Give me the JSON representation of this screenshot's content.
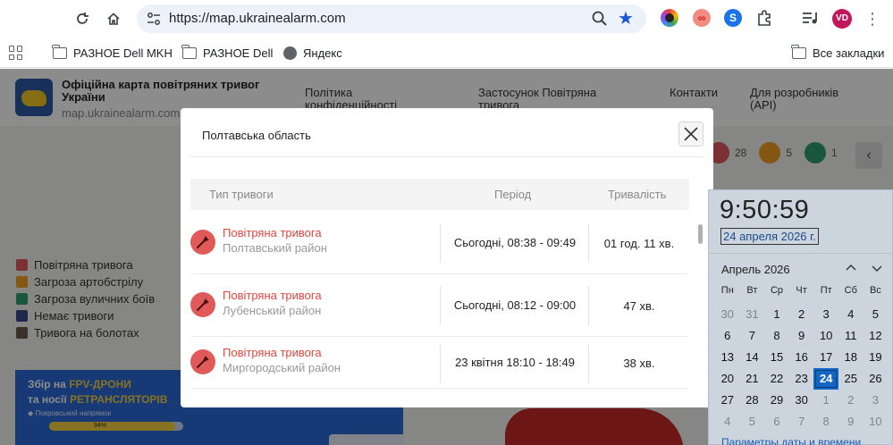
{
  "browser": {
    "url": "https://map.ukrainealarm.com",
    "profile_initials": "VD",
    "ext_infinity": "∞",
    "ext_shazam": "S",
    "bookmarks": [
      {
        "label": "РАЗНОЕ Dell MKH",
        "icon": "folder-icon"
      },
      {
        "label": "РАЗНОЕ Dell",
        "icon": "folder-icon"
      },
      {
        "label": "Яндекс",
        "icon": "globe-icon"
      }
    ],
    "all_bookmarks": "Все закладки"
  },
  "site": {
    "title": "Офіційна карта повітряних тривог України",
    "domain": "map.ukrainealarm.com",
    "nav": [
      "Політика конфіденційності",
      "Застосунок Повітряна тривога",
      "Контакти",
      "Для розробників (API)"
    ],
    "legend": [
      {
        "label": "Повітряна тривога",
        "color": "#e05a5a"
      },
      {
        "label": "Загроза артобстрілу",
        "color": "#f0a020"
      },
      {
        "label": "Загроза вуличних боїв",
        "color": "#2f9e6e"
      },
      {
        "label": "Немає тривоги",
        "color": "#3a4a8a"
      },
      {
        "label": "Тривога на болотах",
        "color": "#6b5a4e"
      }
    ],
    "stats": [
      {
        "value": "28",
        "color": "#e05a5a"
      },
      {
        "value": "5",
        "color": "#f0a020"
      },
      {
        "value": "1",
        "color": "#2f9e6e"
      }
    ],
    "banner": {
      "line1_prefix": "Збір на ",
      "line1_accent": "FPV-ДРОНИ",
      "line2_prefix": "та носії ",
      "line2_accent": "РЕТРАНСЛЯТОРІВ",
      "sub": "◆ Покровський напрямок",
      "progress_label": "94%",
      "progress": 0.94
    }
  },
  "modal": {
    "title": "Полтавська область",
    "columns": [
      "Тип тривоги",
      "Період",
      "Тривалість"
    ],
    "rows": [
      {
        "type": "Повітряна тривога",
        "district": "Полтавський район",
        "period": "Сьогодні, 08:38 - 09:49",
        "duration": "01 год. 11 хв."
      },
      {
        "type": "Повітряна тривога",
        "district": "Лубенський район",
        "period": "Сьогодні, 08:12 - 09:00",
        "duration": "47 хв."
      },
      {
        "type": "Повітряна тривога",
        "district": "Миргородський район",
        "period": "23 квітня 18:10 - 18:49",
        "duration": "38 хв."
      }
    ]
  },
  "clock": {
    "time": "9:50:59",
    "date": "24 апреля 2026 г.",
    "month": "Апрель 2026",
    "weekdays": [
      "Пн",
      "Вт",
      "Ср",
      "Чт",
      "Пт",
      "Сб",
      "Вс"
    ],
    "days": [
      {
        "d": "30",
        "other": true
      },
      {
        "d": "31",
        "other": true
      },
      {
        "d": "1"
      },
      {
        "d": "2"
      },
      {
        "d": "3"
      },
      {
        "d": "4"
      },
      {
        "d": "5"
      },
      {
        "d": "6"
      },
      {
        "d": "7"
      },
      {
        "d": "8"
      },
      {
        "d": "9"
      },
      {
        "d": "10"
      },
      {
        "d": "11"
      },
      {
        "d": "12"
      },
      {
        "d": "13"
      },
      {
        "d": "14"
      },
      {
        "d": "15"
      },
      {
        "d": "16"
      },
      {
        "d": "17"
      },
      {
        "d": "18"
      },
      {
        "d": "19"
      },
      {
        "d": "20"
      },
      {
        "d": "21"
      },
      {
        "d": "22"
      },
      {
        "d": "23"
      },
      {
        "d": "24",
        "today": true
      },
      {
        "d": "25"
      },
      {
        "d": "26"
      },
      {
        "d": "27"
      },
      {
        "d": "28"
      },
      {
        "d": "29"
      },
      {
        "d": "30"
      },
      {
        "d": "1",
        "other": true
      },
      {
        "d": "2",
        "other": true
      },
      {
        "d": "3",
        "other": true
      },
      {
        "d": "4",
        "other": true
      },
      {
        "d": "5",
        "other": true
      },
      {
        "d": "6",
        "other": true
      },
      {
        "d": "7",
        "other": true
      },
      {
        "d": "8",
        "other": true
      },
      {
        "d": "9",
        "other": true
      },
      {
        "d": "10",
        "other": true
      }
    ],
    "settings_link": "Параметры даты и времени"
  }
}
